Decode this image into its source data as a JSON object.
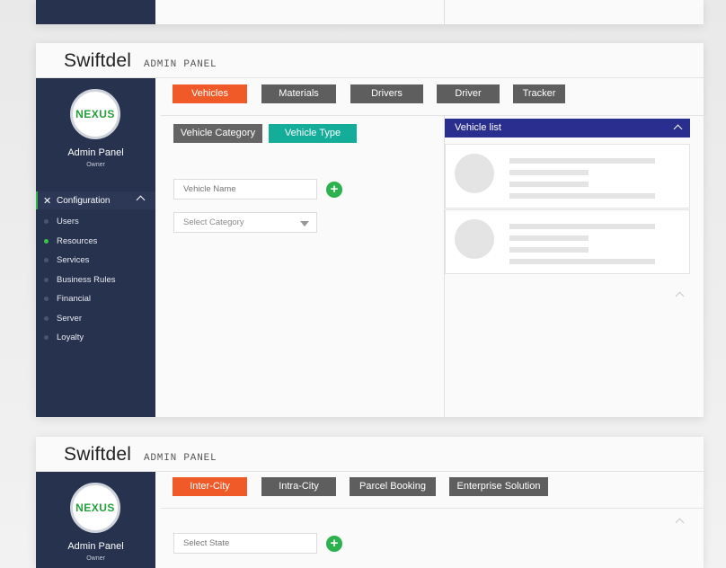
{
  "brand": "Swiftdel",
  "subtitle": "ADMIN PANEL",
  "logo_text_left": "NE",
  "logo_text_mid": "X",
  "logo_text_right": "US",
  "sidebar_title": "Admin Panel",
  "sidebar_role": "Owner",
  "configuration_label": "Configuration",
  "menu": [
    "Users",
    "Resources",
    "Services",
    "Business Rules",
    "Financial",
    "Server",
    "Loyalty"
  ],
  "active_menu": "Resources",
  "panel1": {
    "tabs": [
      "Vehicles",
      "Materials",
      "Drivers",
      "Driver",
      "Tracker"
    ],
    "active_tab": "Vehicles",
    "subtabs": [
      "Vehicle Category",
      "Vehicle Type"
    ],
    "active_subtab": "Vehicle Type",
    "vehicle_name_placeholder": "Vehicle Name",
    "select_category_placeholder": "Select Category",
    "vehicle_list_title": "Vehicle list",
    "vehicle_cards": 2
  },
  "panel2": {
    "tabs": [
      "Inter-City",
      "Intra-City",
      "Parcel Booking",
      "Enterprise Solution"
    ],
    "active_tab": "Inter-City",
    "select_state_placeholder": "Select State"
  },
  "colors": {
    "sidebar": "#27324f",
    "active_tab": "#ef5a28",
    "inactive_tab": "#5e5e5e",
    "active_subtab": "#14ad9a",
    "inactive_subtab": "#646464",
    "list_header": "#2a2f8f",
    "add_button": "#2bb24c",
    "active_dot": "#3cc24f"
  }
}
